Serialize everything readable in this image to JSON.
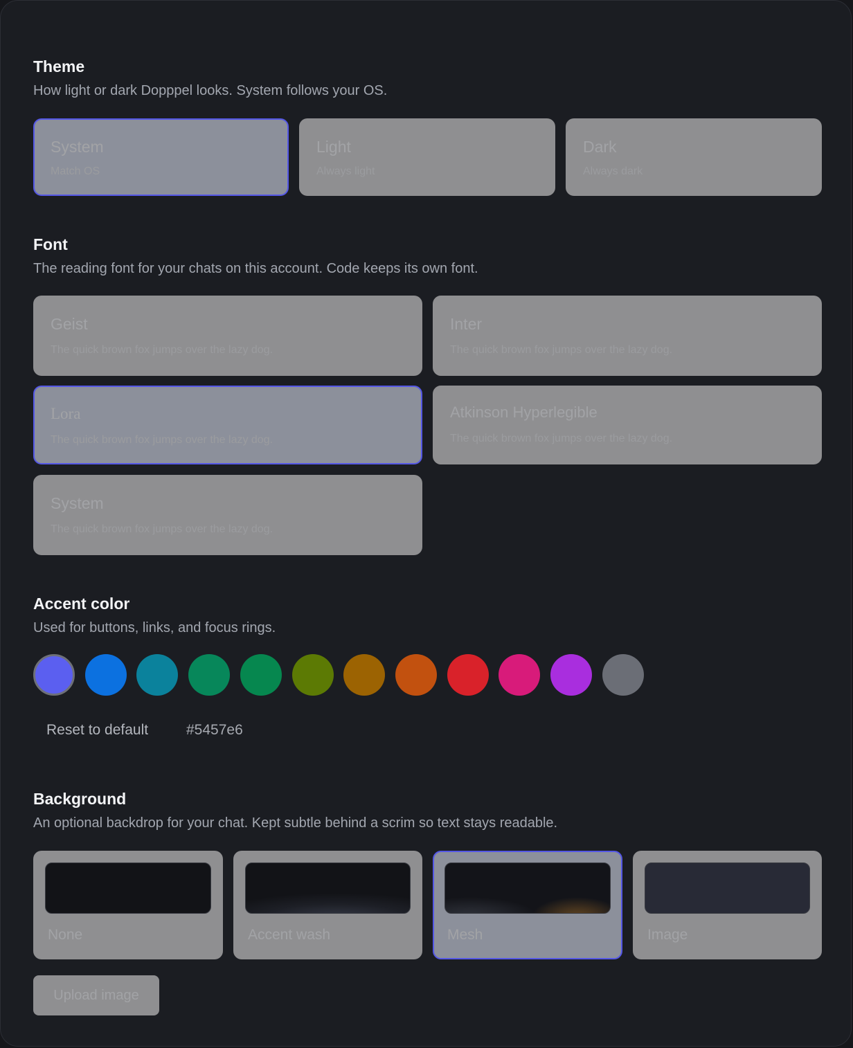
{
  "theme": {
    "title": "Theme",
    "desc": "How light or dark Dopppel looks. System follows your OS.",
    "options": [
      {
        "label": "System",
        "sub": "Match OS",
        "selected": true
      },
      {
        "label": "Light",
        "sub": "Always light",
        "selected": false
      },
      {
        "label": "Dark",
        "sub": "Always dark",
        "selected": false
      }
    ]
  },
  "font": {
    "title": "Font",
    "desc": "The reading font for your chats on this account. Code keeps its own font.",
    "options": [
      {
        "label": "Geist",
        "sub": "The quick brown fox jumps over the lazy dog.",
        "selected": false
      },
      {
        "label": "Inter",
        "sub": "The quick brown fox jumps over the lazy dog.",
        "selected": false
      },
      {
        "label": "Lora",
        "sub": "The quick brown fox jumps over the lazy dog.",
        "selected": true
      },
      {
        "label": "Atkinson Hyperlegible",
        "sub": "The quick brown fox jumps over the lazy dog.",
        "selected": false
      },
      {
        "label": "System",
        "sub": "The quick brown fox jumps over the lazy dog.",
        "selected": false
      }
    ]
  },
  "accent": {
    "title": "Accent color",
    "desc": "Used for buttons, links, and focus rings.",
    "swatches": [
      "#5b5ff0",
      "#0c71e0",
      "#0b829c",
      "#07875a",
      "#06874f",
      "#5c7a04",
      "#9c6302",
      "#c2510f",
      "#d9222a",
      "#d81b7a",
      "#a92ede",
      "#6b6e76"
    ],
    "selected_index": 0,
    "reset_label": "Reset to default",
    "hex_value": "#5457e6"
  },
  "background": {
    "title": "Background",
    "desc": "An optional backdrop for your chat. Kept subtle behind a scrim so text stays readable.",
    "options": [
      {
        "label": "None",
        "selected": false
      },
      {
        "label": "Accent wash",
        "selected": false
      },
      {
        "label": "Mesh",
        "selected": true
      },
      {
        "label": "Image",
        "selected": false
      }
    ],
    "upload_label": "Upload image"
  }
}
